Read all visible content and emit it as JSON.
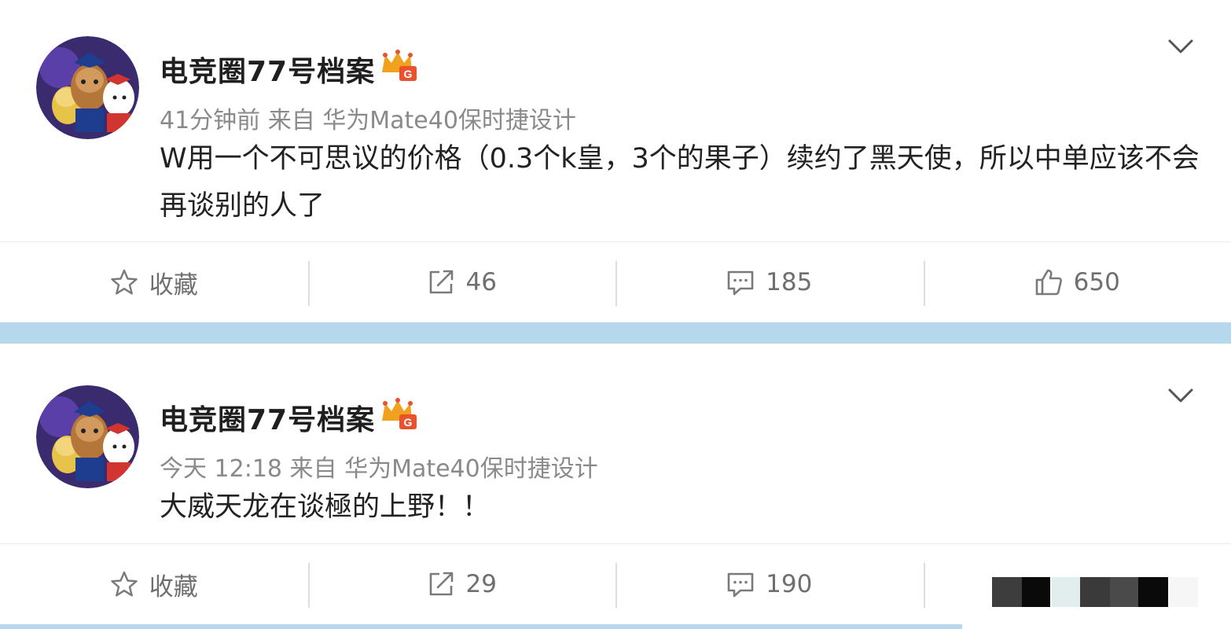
{
  "posts": [
    {
      "username": "电竞圈77号档案",
      "meta": "41分钟前 来自 华为Mate40保时捷设计",
      "content": "W用一个不可思议的价格（0.3个k皇，3个的果子）续约了黑天使，所以中单应该不会再谈别的人了",
      "actions": {
        "favorite_label": "收藏",
        "share_count": "46",
        "comment_count": "185",
        "like_count": "650"
      }
    },
    {
      "username": "电竞圈77号档案",
      "meta": "今天 12:18 来自 华为Mate40保时捷设计",
      "content": "大威天龙在谈極的上野！！",
      "actions": {
        "favorite_label": "收藏",
        "share_count": "29",
        "comment_count": "190"
      }
    }
  ],
  "icons": {
    "favorite": "star-icon",
    "share": "share-icon",
    "comment": "comment-icon",
    "like": "thumbs-up-icon",
    "menu": "chevron-down-icon",
    "badge": "vip-crown-badge-icon"
  },
  "colors": {
    "separator": "#b6d8ec",
    "text_muted": "#8a8a8a",
    "text_main": "#222222",
    "badge_gold": "#f0a21e",
    "badge_red": "#e8532d"
  }
}
